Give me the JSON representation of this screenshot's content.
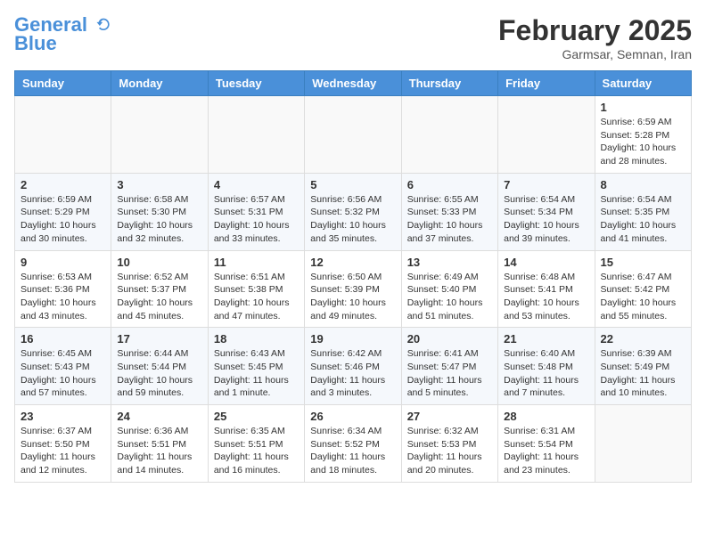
{
  "header": {
    "logo_line1": "General",
    "logo_line2": "Blue",
    "month": "February 2025",
    "location": "Garmsar, Semnan, Iran"
  },
  "weekdays": [
    "Sunday",
    "Monday",
    "Tuesday",
    "Wednesday",
    "Thursday",
    "Friday",
    "Saturday"
  ],
  "weeks": [
    [
      {
        "day": "",
        "info": ""
      },
      {
        "day": "",
        "info": ""
      },
      {
        "day": "",
        "info": ""
      },
      {
        "day": "",
        "info": ""
      },
      {
        "day": "",
        "info": ""
      },
      {
        "day": "",
        "info": ""
      },
      {
        "day": "1",
        "info": "Sunrise: 6:59 AM\nSunset: 5:28 PM\nDaylight: 10 hours and 28 minutes."
      }
    ],
    [
      {
        "day": "2",
        "info": "Sunrise: 6:59 AM\nSunset: 5:29 PM\nDaylight: 10 hours and 30 minutes."
      },
      {
        "day": "3",
        "info": "Sunrise: 6:58 AM\nSunset: 5:30 PM\nDaylight: 10 hours and 32 minutes."
      },
      {
        "day": "4",
        "info": "Sunrise: 6:57 AM\nSunset: 5:31 PM\nDaylight: 10 hours and 33 minutes."
      },
      {
        "day": "5",
        "info": "Sunrise: 6:56 AM\nSunset: 5:32 PM\nDaylight: 10 hours and 35 minutes."
      },
      {
        "day": "6",
        "info": "Sunrise: 6:55 AM\nSunset: 5:33 PM\nDaylight: 10 hours and 37 minutes."
      },
      {
        "day": "7",
        "info": "Sunrise: 6:54 AM\nSunset: 5:34 PM\nDaylight: 10 hours and 39 minutes."
      },
      {
        "day": "8",
        "info": "Sunrise: 6:54 AM\nSunset: 5:35 PM\nDaylight: 10 hours and 41 minutes."
      }
    ],
    [
      {
        "day": "9",
        "info": "Sunrise: 6:53 AM\nSunset: 5:36 PM\nDaylight: 10 hours and 43 minutes."
      },
      {
        "day": "10",
        "info": "Sunrise: 6:52 AM\nSunset: 5:37 PM\nDaylight: 10 hours and 45 minutes."
      },
      {
        "day": "11",
        "info": "Sunrise: 6:51 AM\nSunset: 5:38 PM\nDaylight: 10 hours and 47 minutes."
      },
      {
        "day": "12",
        "info": "Sunrise: 6:50 AM\nSunset: 5:39 PM\nDaylight: 10 hours and 49 minutes."
      },
      {
        "day": "13",
        "info": "Sunrise: 6:49 AM\nSunset: 5:40 PM\nDaylight: 10 hours and 51 minutes."
      },
      {
        "day": "14",
        "info": "Sunrise: 6:48 AM\nSunset: 5:41 PM\nDaylight: 10 hours and 53 minutes."
      },
      {
        "day": "15",
        "info": "Sunrise: 6:47 AM\nSunset: 5:42 PM\nDaylight: 10 hours and 55 minutes."
      }
    ],
    [
      {
        "day": "16",
        "info": "Sunrise: 6:45 AM\nSunset: 5:43 PM\nDaylight: 10 hours and 57 minutes."
      },
      {
        "day": "17",
        "info": "Sunrise: 6:44 AM\nSunset: 5:44 PM\nDaylight: 10 hours and 59 minutes."
      },
      {
        "day": "18",
        "info": "Sunrise: 6:43 AM\nSunset: 5:45 PM\nDaylight: 11 hours and 1 minute."
      },
      {
        "day": "19",
        "info": "Sunrise: 6:42 AM\nSunset: 5:46 PM\nDaylight: 11 hours and 3 minutes."
      },
      {
        "day": "20",
        "info": "Sunrise: 6:41 AM\nSunset: 5:47 PM\nDaylight: 11 hours and 5 minutes."
      },
      {
        "day": "21",
        "info": "Sunrise: 6:40 AM\nSunset: 5:48 PM\nDaylight: 11 hours and 7 minutes."
      },
      {
        "day": "22",
        "info": "Sunrise: 6:39 AM\nSunset: 5:49 PM\nDaylight: 11 hours and 10 minutes."
      }
    ],
    [
      {
        "day": "23",
        "info": "Sunrise: 6:37 AM\nSunset: 5:50 PM\nDaylight: 11 hours and 12 minutes."
      },
      {
        "day": "24",
        "info": "Sunrise: 6:36 AM\nSunset: 5:51 PM\nDaylight: 11 hours and 14 minutes."
      },
      {
        "day": "25",
        "info": "Sunrise: 6:35 AM\nSunset: 5:51 PM\nDaylight: 11 hours and 16 minutes."
      },
      {
        "day": "26",
        "info": "Sunrise: 6:34 AM\nSunset: 5:52 PM\nDaylight: 11 hours and 18 minutes."
      },
      {
        "day": "27",
        "info": "Sunrise: 6:32 AM\nSunset: 5:53 PM\nDaylight: 11 hours and 20 minutes."
      },
      {
        "day": "28",
        "info": "Sunrise: 6:31 AM\nSunset: 5:54 PM\nDaylight: 11 hours and 23 minutes."
      },
      {
        "day": "",
        "info": ""
      }
    ]
  ]
}
